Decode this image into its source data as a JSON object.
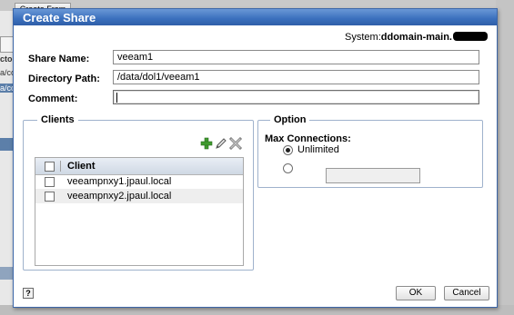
{
  "background": {
    "toolbar_button": "Create From",
    "side_texts": [
      "ctor",
      "a/co",
      "a/co"
    ]
  },
  "dialog": {
    "title": "Create Share",
    "system_prefix": "System:",
    "system_host": "ddomain-main.",
    "fields": {
      "share_name_label": "Share Name:",
      "share_name_value": "veeam1",
      "directory_path_label": "Directory Path:",
      "directory_path_value": "/data/dol1/veeam1",
      "comment_label": "Comment:",
      "comment_value": ""
    },
    "clients": {
      "legend": "Clients",
      "column_header": "Client",
      "rows": [
        "veeampnxy1.jpaul.local",
        "veeampnxy2.jpaul.local"
      ]
    },
    "option": {
      "legend": "Option",
      "max_connections_label": "Max Connections:",
      "unlimited_label": "Unlimited",
      "unlimited_selected": true,
      "custom_value": ""
    },
    "help_glyph": "?",
    "ok_label": "OK",
    "cancel_label": "Cancel"
  },
  "colors": {
    "titlebar": "#3a6fbd",
    "group_border": "#9fb2cc",
    "add_icon": "#3f9a2e"
  },
  "icons": {
    "add": "plus-icon",
    "edit": "pencil-icon",
    "delete": "x-icon"
  }
}
